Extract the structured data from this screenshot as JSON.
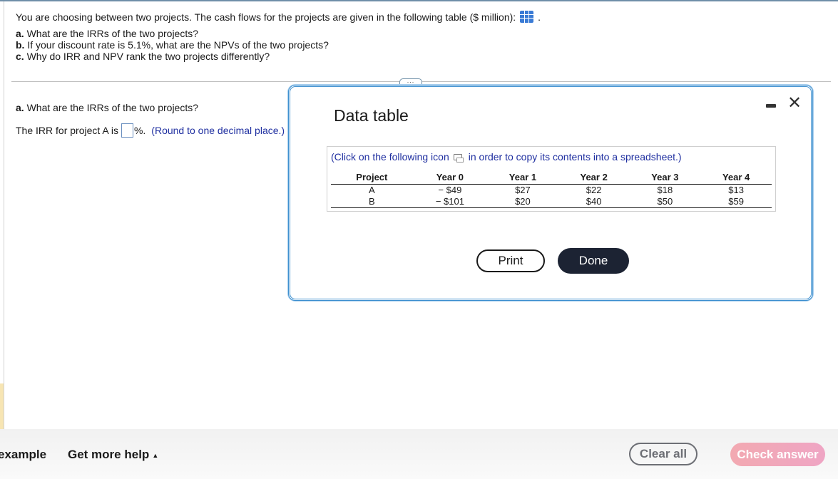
{
  "question": {
    "intro": "You are choosing between two projects. The cash flows for the projects are given in the following table ($ million):",
    "intro_icon": "table-grid-icon",
    "parts": [
      {
        "label": "a.",
        "text": " What are the IRRs of the two projects?"
      },
      {
        "label": "b.",
        "text": " If your discount rate is 5.1%, what are the NPVs of the two projects?"
      },
      {
        "label": "c.",
        "text": " Why do IRR and NPV rank the two projects differently?"
      }
    ]
  },
  "answer_section": {
    "part_label": "a.",
    "part_text": " What are the IRRs of the two projects?",
    "prompt_prefix": "The IRR for project A is",
    "input_value": "",
    "prompt_suffix": "%.",
    "hint": "(Round to one decimal place.)"
  },
  "modal": {
    "title": "Data table",
    "copy_note_prefix": "(Click on the following icon",
    "copy_note_suffix": "in order to copy its contents into a spreadsheet.)",
    "table": {
      "headers": [
        "Project",
        "Year 0",
        "Year 1",
        "Year 2",
        "Year 3",
        "Year 4"
      ],
      "rows": [
        [
          "A",
          "− $49",
          "$27",
          "$22",
          "$18",
          "$13"
        ],
        [
          "B",
          "− $101",
          "$20",
          "$40",
          "$50",
          "$59"
        ]
      ]
    },
    "print_label": "Print",
    "done_label": "Done"
  },
  "footer": {
    "example_label": "example",
    "help_label": "Get more help",
    "clear_label": "Clear all",
    "check_label": "Check answer"
  },
  "colors": {
    "accent_blue": "#3d8fcf",
    "hint_blue": "#1f2fa0",
    "done_dark": "#1c2333",
    "check_pink": "#f2a9b1"
  }
}
